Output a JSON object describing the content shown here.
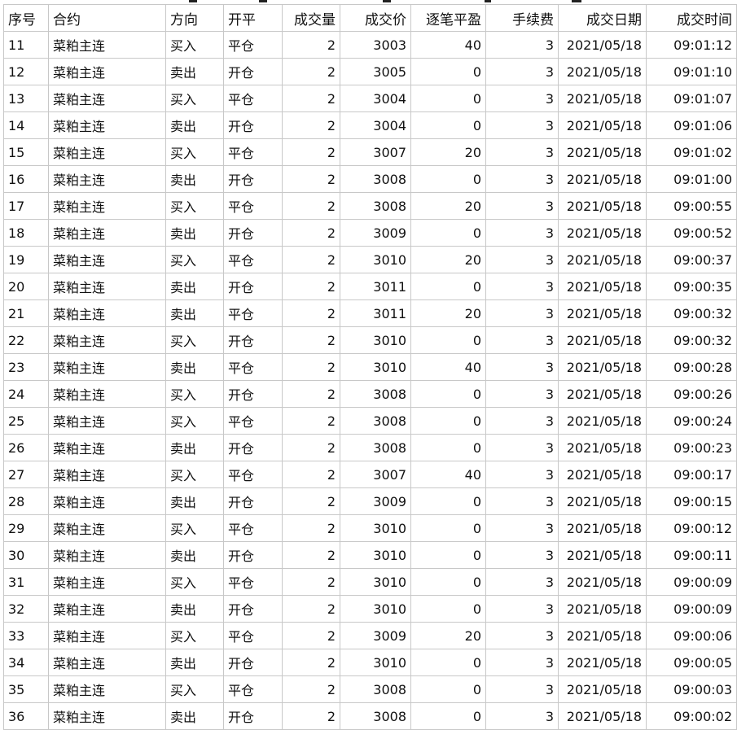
{
  "columns": [
    "序号",
    "合约",
    "方向",
    "开平",
    "成交量",
    "成交价",
    "逐笔平盈",
    "手续费",
    "成交日期",
    "成交时间"
  ],
  "colors": {
    "buy": "#e0281e",
    "sell": "#1f9d2c",
    "profit": "#e0281e",
    "grid": "#c8c8c8"
  },
  "rows": [
    {
      "id": "11",
      "contract": "菜粕主连",
      "dir": "买入",
      "oc": "平仓",
      "vol": "2",
      "price": "3003",
      "pnl": "40",
      "fee": "3",
      "date": "2021/05/18",
      "time": "09:01:12"
    },
    {
      "id": "12",
      "contract": "菜粕主连",
      "dir": "卖出",
      "oc": "开仓",
      "vol": "2",
      "price": "3005",
      "pnl": "0",
      "fee": "3",
      "date": "2021/05/18",
      "time": "09:01:10"
    },
    {
      "id": "13",
      "contract": "菜粕主连",
      "dir": "买入",
      "oc": "平仓",
      "vol": "2",
      "price": "3004",
      "pnl": "0",
      "fee": "3",
      "date": "2021/05/18",
      "time": "09:01:07"
    },
    {
      "id": "14",
      "contract": "菜粕主连",
      "dir": "卖出",
      "oc": "开仓",
      "vol": "2",
      "price": "3004",
      "pnl": "0",
      "fee": "3",
      "date": "2021/05/18",
      "time": "09:01:06"
    },
    {
      "id": "15",
      "contract": "菜粕主连",
      "dir": "买入",
      "oc": "平仓",
      "vol": "2",
      "price": "3007",
      "pnl": "20",
      "fee": "3",
      "date": "2021/05/18",
      "time": "09:01:02"
    },
    {
      "id": "16",
      "contract": "菜粕主连",
      "dir": "卖出",
      "oc": "开仓",
      "vol": "2",
      "price": "3008",
      "pnl": "0",
      "fee": "3",
      "date": "2021/05/18",
      "time": "09:01:00"
    },
    {
      "id": "17",
      "contract": "菜粕主连",
      "dir": "买入",
      "oc": "平仓",
      "vol": "2",
      "price": "3008",
      "pnl": "20",
      "fee": "3",
      "date": "2021/05/18",
      "time": "09:00:55"
    },
    {
      "id": "18",
      "contract": "菜粕主连",
      "dir": "卖出",
      "oc": "开仓",
      "vol": "2",
      "price": "3009",
      "pnl": "0",
      "fee": "3",
      "date": "2021/05/18",
      "time": "09:00:52"
    },
    {
      "id": "19",
      "contract": "菜粕主连",
      "dir": "买入",
      "oc": "平仓",
      "vol": "2",
      "price": "3010",
      "pnl": "20",
      "fee": "3",
      "date": "2021/05/18",
      "time": "09:00:37"
    },
    {
      "id": "20",
      "contract": "菜粕主连",
      "dir": "卖出",
      "oc": "开仓",
      "vol": "2",
      "price": "3011",
      "pnl": "0",
      "fee": "3",
      "date": "2021/05/18",
      "time": "09:00:35"
    },
    {
      "id": "21",
      "contract": "菜粕主连",
      "dir": "卖出",
      "oc": "平仓",
      "vol": "2",
      "price": "3011",
      "pnl": "20",
      "fee": "3",
      "date": "2021/05/18",
      "time": "09:00:32"
    },
    {
      "id": "22",
      "contract": "菜粕主连",
      "dir": "买入",
      "oc": "开仓",
      "vol": "2",
      "price": "3010",
      "pnl": "0",
      "fee": "3",
      "date": "2021/05/18",
      "time": "09:00:32"
    },
    {
      "id": "23",
      "contract": "菜粕主连",
      "dir": "卖出",
      "oc": "平仓",
      "vol": "2",
      "price": "3010",
      "pnl": "40",
      "fee": "3",
      "date": "2021/05/18",
      "time": "09:00:28"
    },
    {
      "id": "24",
      "contract": "菜粕主连",
      "dir": "买入",
      "oc": "开仓",
      "vol": "2",
      "price": "3008",
      "pnl": "0",
      "fee": "3",
      "date": "2021/05/18",
      "time": "09:00:26"
    },
    {
      "id": "25",
      "contract": "菜粕主连",
      "dir": "买入",
      "oc": "平仓",
      "vol": "2",
      "price": "3008",
      "pnl": "0",
      "fee": "3",
      "date": "2021/05/18",
      "time": "09:00:24"
    },
    {
      "id": "26",
      "contract": "菜粕主连",
      "dir": "卖出",
      "oc": "开仓",
      "vol": "2",
      "price": "3008",
      "pnl": "0",
      "fee": "3",
      "date": "2021/05/18",
      "time": "09:00:23"
    },
    {
      "id": "27",
      "contract": "菜粕主连",
      "dir": "买入",
      "oc": "平仓",
      "vol": "2",
      "price": "3007",
      "pnl": "40",
      "fee": "3",
      "date": "2021/05/18",
      "time": "09:00:17"
    },
    {
      "id": "28",
      "contract": "菜粕主连",
      "dir": "卖出",
      "oc": "开仓",
      "vol": "2",
      "price": "3009",
      "pnl": "0",
      "fee": "3",
      "date": "2021/05/18",
      "time": "09:00:15"
    },
    {
      "id": "29",
      "contract": "菜粕主连",
      "dir": "买入",
      "oc": "平仓",
      "vol": "2",
      "price": "3010",
      "pnl": "0",
      "fee": "3",
      "date": "2021/05/18",
      "time": "09:00:12"
    },
    {
      "id": "30",
      "contract": "菜粕主连",
      "dir": "卖出",
      "oc": "开仓",
      "vol": "2",
      "price": "3010",
      "pnl": "0",
      "fee": "3",
      "date": "2021/05/18",
      "time": "09:00:11"
    },
    {
      "id": "31",
      "contract": "菜粕主连",
      "dir": "买入",
      "oc": "平仓",
      "vol": "2",
      "price": "3010",
      "pnl": "0",
      "fee": "3",
      "date": "2021/05/18",
      "time": "09:00:09"
    },
    {
      "id": "32",
      "contract": "菜粕主连",
      "dir": "卖出",
      "oc": "开仓",
      "vol": "2",
      "price": "3010",
      "pnl": "0",
      "fee": "3",
      "date": "2021/05/18",
      "time": "09:00:09"
    },
    {
      "id": "33",
      "contract": "菜粕主连",
      "dir": "买入",
      "oc": "平仓",
      "vol": "2",
      "price": "3009",
      "pnl": "20",
      "fee": "3",
      "date": "2021/05/18",
      "time": "09:00:06"
    },
    {
      "id": "34",
      "contract": "菜粕主连",
      "dir": "卖出",
      "oc": "开仓",
      "vol": "2",
      "price": "3010",
      "pnl": "0",
      "fee": "3",
      "date": "2021/05/18",
      "time": "09:00:05"
    },
    {
      "id": "35",
      "contract": "菜粕主连",
      "dir": "买入",
      "oc": "平仓",
      "vol": "2",
      "price": "3008",
      "pnl": "0",
      "fee": "3",
      "date": "2021/05/18",
      "time": "09:00:03"
    },
    {
      "id": "36",
      "contract": "菜粕主连",
      "dir": "卖出",
      "oc": "开仓",
      "vol": "2",
      "price": "3008",
      "pnl": "0",
      "fee": "3",
      "date": "2021/05/18",
      "time": "09:00:02"
    }
  ]
}
